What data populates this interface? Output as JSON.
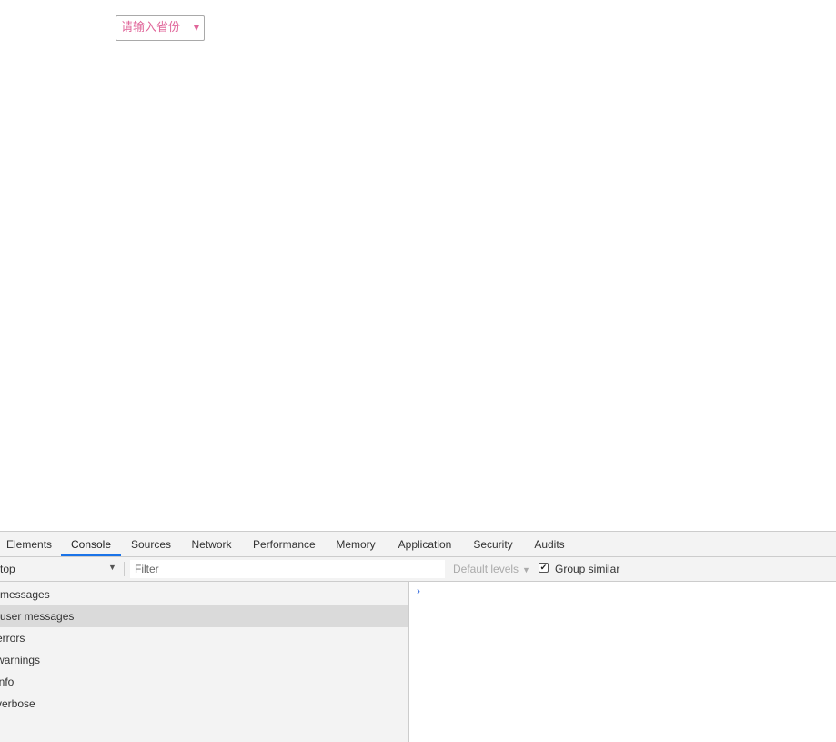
{
  "page": {
    "province_select": {
      "value": "请输入省份",
      "arrow": "▼"
    }
  },
  "devtools": {
    "tabs": [
      {
        "label": "Elements"
      },
      {
        "label": "Console",
        "active": true
      },
      {
        "label": "Sources"
      },
      {
        "label": "Network"
      },
      {
        "label": "Performance"
      },
      {
        "label": "Memory"
      },
      {
        "label": "Application"
      },
      {
        "label": "Security"
      },
      {
        "label": "Audits"
      }
    ],
    "toolbar": {
      "context": "top",
      "context_arrow": "▼",
      "filter_placeholder": "Filter",
      "levels": "Default levels",
      "levels_arrow": "▼",
      "group_similar": "Group similar",
      "group_similar_checked": true,
      "check_glyph": "✔"
    },
    "sidebar": {
      "items": [
        {
          "label": "messages"
        },
        {
          "label": "user messages",
          "selected": true
        },
        {
          "label": "errors"
        },
        {
          "label": "warnings"
        },
        {
          "label": "info"
        },
        {
          "label": "verbose"
        }
      ]
    },
    "console": {
      "prompt": "›"
    }
  },
  "colors": {
    "select_text": "#e0669a",
    "active_tab_underline": "#1a73e8",
    "prompt": "#4a7ae0",
    "selected_row": "#dadada"
  }
}
